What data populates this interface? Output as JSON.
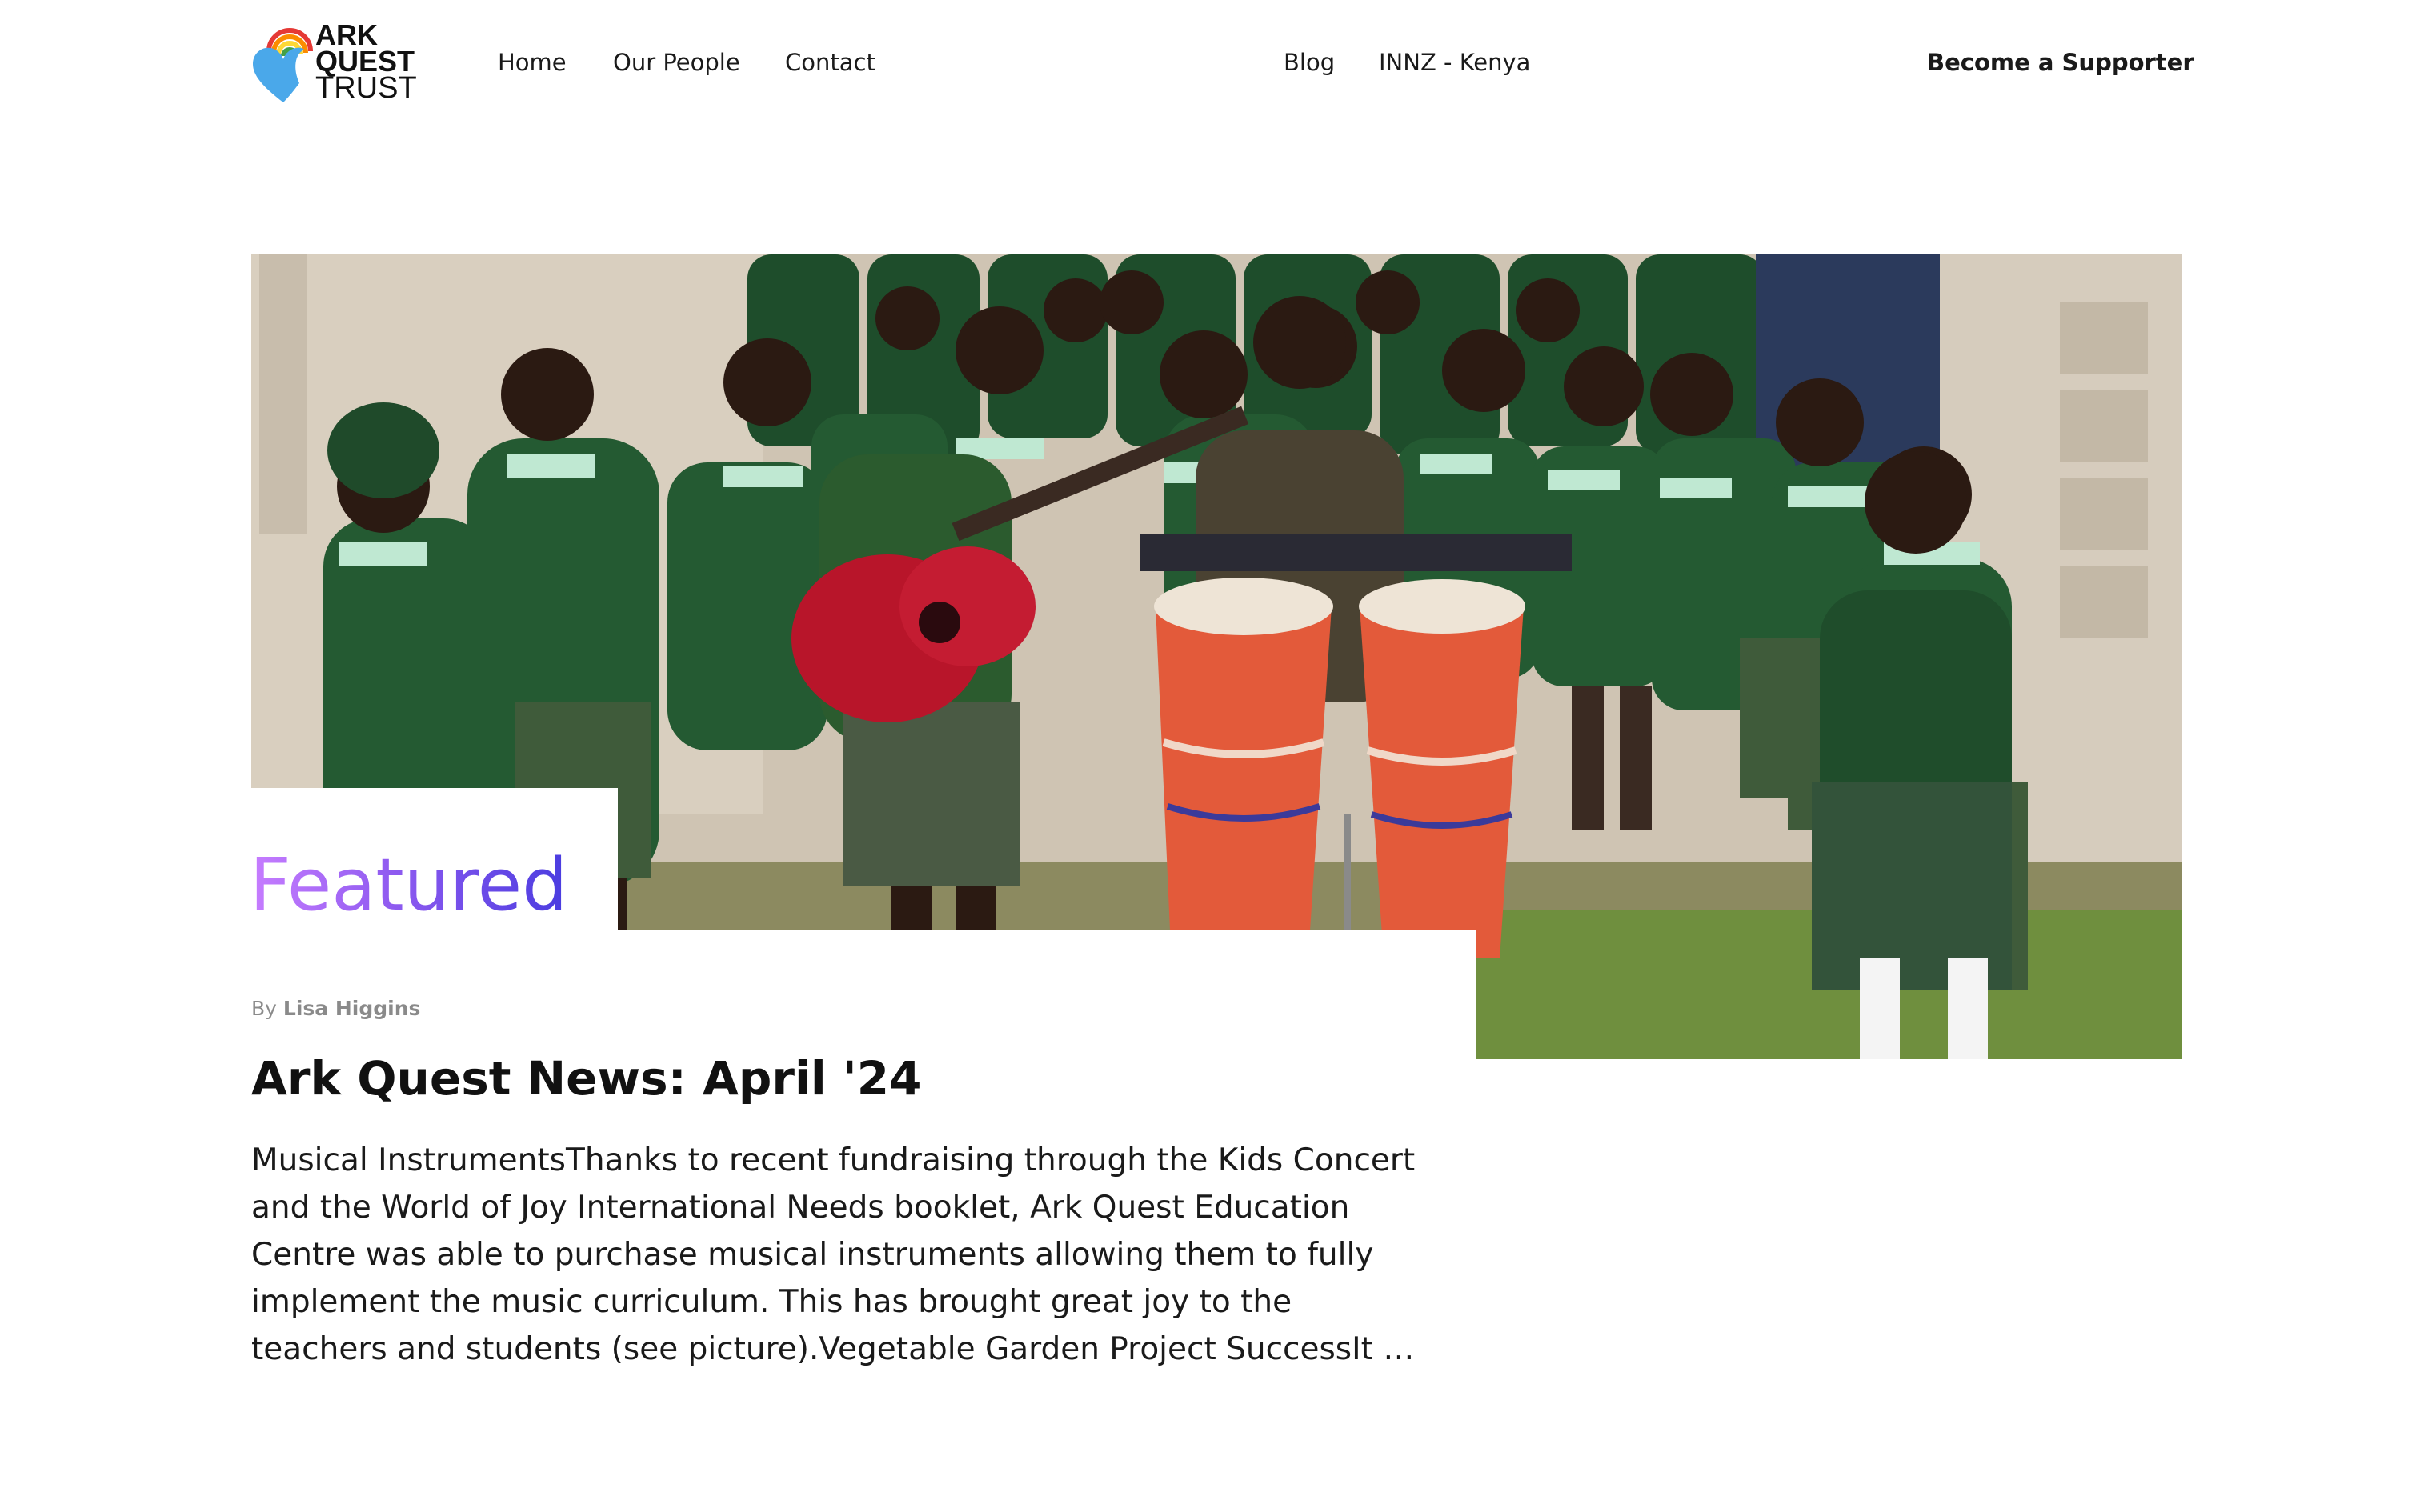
{
  "header": {
    "logo": {
      "line1": "ARK",
      "line2": "QUEST",
      "line3": "TRUST",
      "icon": "heart-rainbow-icon",
      "colors": {
        "heart": "#4aa8ea",
        "rainbow": [
          "#e53935",
          "#fb8c00",
          "#fdd835",
          "#43a047"
        ]
      }
    },
    "nav": {
      "home": "Home",
      "our_people": "Our People",
      "contact": "Contact",
      "blog": "Blog",
      "innz": "INNZ - Kenya",
      "become_supporter": "Become a Supporter"
    }
  },
  "featured": {
    "label": "Featured",
    "label_gradient": [
      "#c77dff",
      "#4a3ce0"
    ],
    "image": {
      "alt": "Students in green uniforms playing guitar and conga drums outdoors"
    },
    "byline_prefix": "By",
    "author": "Lisa Higgins",
    "title": "Ark Quest News: April '24",
    "excerpt": "Musical InstrumentsThanks to recent fundraising through the Kids Concert and the World of Joy International Needs booklet, Ark Quest Education Centre was able to purchase musical instruments allowing them to fully implement the music curriculum. This has brought great joy to the teachers and students (see picture).Vegetable Garden Project SuccessIt …"
  }
}
